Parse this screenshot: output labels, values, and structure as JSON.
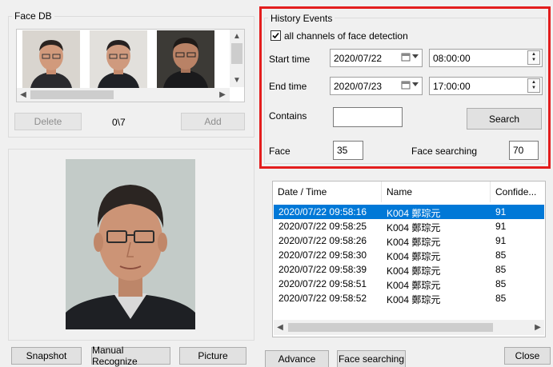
{
  "face_db": {
    "title": "Face DB",
    "delete_label": "Delete",
    "count": "0\\7",
    "add_label": "Add"
  },
  "history": {
    "title": "History Events",
    "all_channels_label": "all channels of face detection",
    "all_channels_checked": true,
    "start_time_label": "Start time",
    "start_date": "2020/07/22",
    "start_time": "08:00:00",
    "end_time_label": "End time",
    "end_date": "2020/07/23",
    "end_time": "17:00:00",
    "contains_label": "Contains",
    "contains_value": "",
    "search_label": "Search",
    "face_label": "Face",
    "face_value": "35",
    "face_searching_label": "Face searching",
    "face_searching_value": "70"
  },
  "results": {
    "columns": [
      "Date / Time",
      "Name",
      "Confide..."
    ],
    "rows": [
      {
        "datetime": "2020/07/22 09:58:16",
        "name": "K004 鄭琮元",
        "confidence": "91",
        "selected": true
      },
      {
        "datetime": "2020/07/22 09:58:25",
        "name": "K004 鄭琮元",
        "confidence": "91",
        "selected": false
      },
      {
        "datetime": "2020/07/22 09:58:26",
        "name": "K004 鄭琮元",
        "confidence": "91",
        "selected": false
      },
      {
        "datetime": "2020/07/22 09:58:30",
        "name": "K004 鄭琮元",
        "confidence": "85",
        "selected": false
      },
      {
        "datetime": "2020/07/22 09:58:39",
        "name": "K004 鄭琮元",
        "confidence": "85",
        "selected": false
      },
      {
        "datetime": "2020/07/22 09:58:51",
        "name": "K004 鄭琮元",
        "confidence": "85",
        "selected": false
      },
      {
        "datetime": "2020/07/22 09:58:52",
        "name": "K004 鄭琮元",
        "confidence": "85",
        "selected": false
      }
    ]
  },
  "bottom_buttons": {
    "snapshot": "Snapshot",
    "manual_recognize": "Manual Recognize",
    "picture": "Picture",
    "advance": "Advance",
    "face_searching": "Face searching",
    "close": "Close"
  },
  "colors": {
    "highlight_box": "#e31d1d",
    "selection": "#0078d7"
  }
}
